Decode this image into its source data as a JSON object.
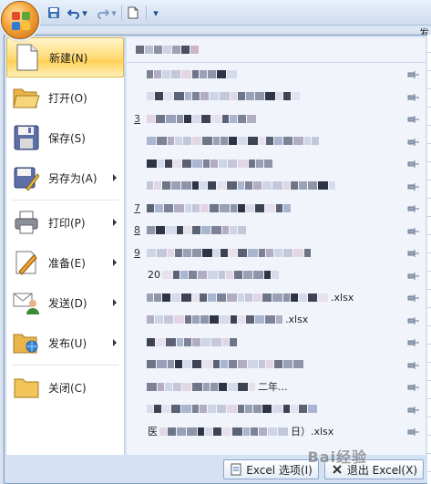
{
  "app": {
    "title_right_fragment": "发",
    "accent": "#ffd970"
  },
  "quick_access": [
    {
      "name": "save-icon"
    },
    {
      "name": "undo-icon"
    },
    {
      "name": "redo-icon"
    },
    {
      "name": "new-document-icon"
    },
    {
      "name": "customize-toolbar-icon"
    }
  ],
  "menu": {
    "commands": [
      {
        "label": "新建(N)",
        "icon": "new-icon",
        "submenu": false
      },
      {
        "label": "打开(O)",
        "icon": "open-folder-icon",
        "submenu": false
      },
      {
        "label": "保存(S)",
        "icon": "floppy-save-icon",
        "submenu": false
      },
      {
        "label": "另存为(A)",
        "icon": "save-as-icon",
        "submenu": true
      },
      {
        "label": "打印(P)",
        "icon": "printer-icon",
        "submenu": true
      },
      {
        "label": "准备(E)",
        "icon": "prepare-pencil-icon",
        "submenu": true
      },
      {
        "label": "发送(D)",
        "icon": "send-people-icon",
        "submenu": true
      },
      {
        "label": "发布(U)",
        "icon": "publish-folder-icon",
        "submenu": true
      },
      {
        "label": "关闭(C)",
        "icon": "close-folder-icon",
        "submenu": false
      }
    ]
  },
  "recent": {
    "rows": [
      {
        "num": "",
        "suffix": ""
      },
      {
        "num": "",
        "suffix": ""
      },
      {
        "num": "3",
        "suffix": ""
      },
      {
        "num": "",
        "suffix": ""
      },
      {
        "num": "",
        "suffix": ""
      },
      {
        "num": "",
        "suffix": ""
      },
      {
        "num": "7",
        "suffix": ""
      },
      {
        "num": "8",
        "suffix": ""
      },
      {
        "num": "9",
        "suffix": ""
      },
      {
        "num": "",
        "prefix": "20",
        "suffix": ""
      },
      {
        "num": "",
        "suffix": ".xlsx"
      },
      {
        "num": "",
        "suffix": ".xlsx"
      },
      {
        "num": "",
        "suffix": ""
      },
      {
        "num": "",
        "suffix": ""
      },
      {
        "num": "",
        "suffix": "二年..."
      },
      {
        "num": "",
        "suffix": ""
      },
      {
        "num": "",
        "prefix": "医",
        "suffix": "日）.xlsx"
      }
    ]
  },
  "bottom": {
    "options_label": "Excel 选项(I)",
    "exit_label": "退出 Excel(X)"
  },
  "watermark": "Bai经验"
}
